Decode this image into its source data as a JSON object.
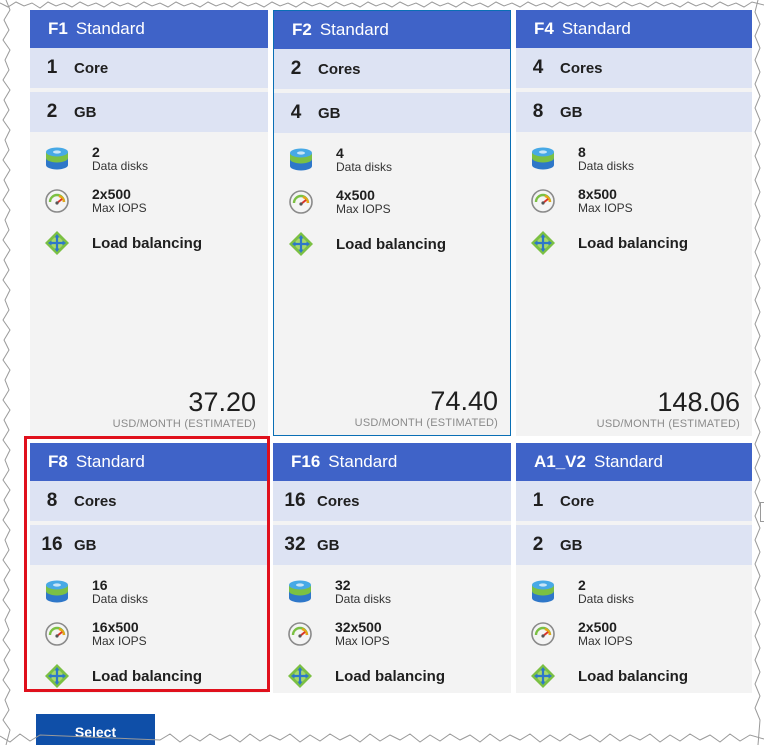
{
  "cards": [
    {
      "tier": "F1",
      "plan": "Standard",
      "cores_num": "1",
      "cores_label": "Core",
      "ram_num": "2",
      "ram_label": "GB",
      "disks_num": "2",
      "disks_label": "Data disks",
      "iops_num": "2x500",
      "iops_label": "Max IOPS",
      "lb_label": "Load balancing",
      "price": "37.20",
      "price_unit": "USD/MONTH (ESTIMATED)"
    },
    {
      "tier": "F2",
      "plan": "Standard",
      "cores_num": "2",
      "cores_label": "Cores",
      "ram_num": "4",
      "ram_label": "GB",
      "disks_num": "4",
      "disks_label": "Data disks",
      "iops_num": "4x500",
      "iops_label": "Max IOPS",
      "lb_label": "Load balancing",
      "price": "74.40",
      "price_unit": "USD/MONTH (ESTIMATED)"
    },
    {
      "tier": "F4",
      "plan": "Standard",
      "cores_num": "4",
      "cores_label": "Cores",
      "ram_num": "8",
      "ram_label": "GB",
      "disks_num": "8",
      "disks_label": "Data disks",
      "iops_num": "8x500",
      "iops_label": "Max IOPS",
      "lb_label": "Load balancing",
      "price": "148.06",
      "price_unit": "USD/MONTH (ESTIMATED)"
    },
    {
      "tier": "F8",
      "plan": "Standard",
      "cores_num": "8",
      "cores_label": "Cores",
      "ram_num": "16",
      "ram_label": "GB",
      "disks_num": "16",
      "disks_label": "Data disks",
      "iops_num": "16x500",
      "iops_label": "Max IOPS",
      "lb_label": "Load balancing"
    },
    {
      "tier": "F16",
      "plan": "Standard",
      "cores_num": "16",
      "cores_label": "Cores",
      "ram_num": "32",
      "ram_label": "GB",
      "disks_num": "32",
      "disks_label": "Data disks",
      "iops_num": "32x500",
      "iops_label": "Max IOPS",
      "lb_label": "Load balancing"
    },
    {
      "tier": "A1_V2",
      "plan": "Standard",
      "cores_num": "1",
      "cores_label": "Core",
      "ram_num": "2",
      "ram_label": "GB",
      "disks_num": "2",
      "disks_label": "Data disks",
      "iops_num": "2x500",
      "iops_label": "Max IOPS",
      "lb_label": "Load balancing"
    }
  ],
  "select_button": {
    "label": "Select"
  },
  "icons": {
    "disks": "data-disks-icon",
    "iops": "iops-gauge-icon",
    "lb": "load-balancing-icon"
  },
  "colors": {
    "header": "#3f63c8",
    "spec_row": "#dde3f3",
    "card_bg": "#f3f3f3",
    "highlight": "#e0101c",
    "button": "#0f4fa8"
  }
}
